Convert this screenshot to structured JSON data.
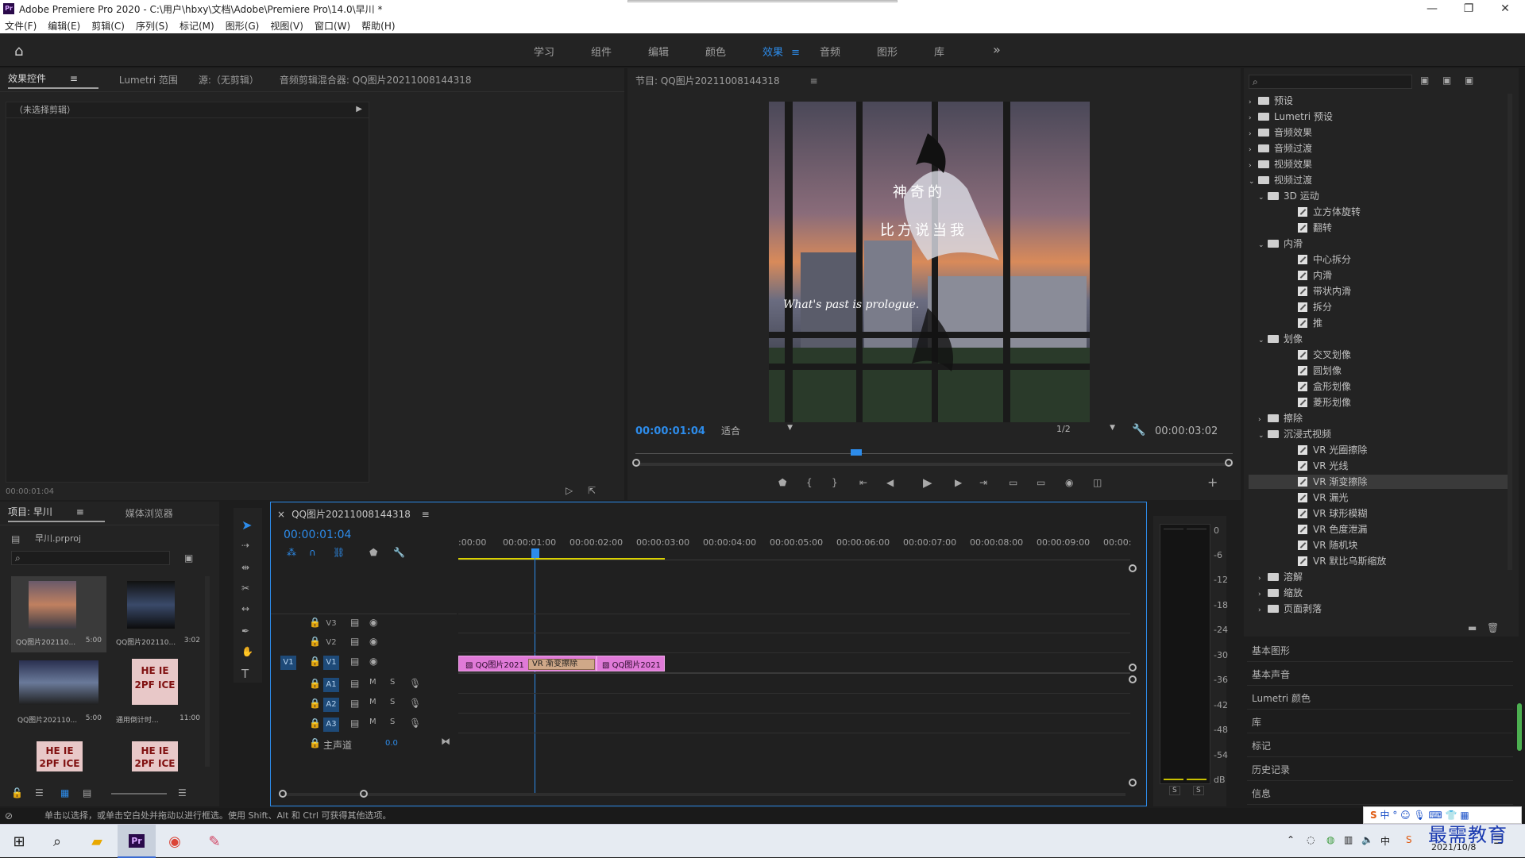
{
  "titlebar": {
    "title": "Adobe Premiere Pro 2020 - C:\\用户\\hbxy\\文档\\Adobe\\Premiere Pro\\14.0\\早川 *",
    "min": "—",
    "max": "❐",
    "close": "✕"
  },
  "menu": [
    "文件(F)",
    "编辑(E)",
    "剪辑(C)",
    "序列(S)",
    "标记(M)",
    "图形(G)",
    "视图(V)",
    "窗口(W)",
    "帮助(H)"
  ],
  "workspaces": [
    "学习",
    "组件",
    "编辑",
    "颜色",
    "效果",
    "音频",
    "图形",
    "库"
  ],
  "workspace_active_index": 4,
  "ws_more": "»",
  "source_tabs": [
    "效果控件",
    "Lumetri 范围",
    "源:（无剪辑）",
    "音频剪辑混合器: QQ图片20211008144318"
  ],
  "effect_controls": {
    "no_clip": "（未选择剪辑）",
    "timecode": "00:00:01:04"
  },
  "program": {
    "title": "节目: QQ图片20211008144318",
    "tc_left": "00:00:01:04",
    "fit": "适合",
    "quality": "1/2",
    "tc_right": "00:00:03:02",
    "overlay": {
      "line1": "神奇的",
      "line2": "比方说当我",
      "line3": "What's past is prologue."
    }
  },
  "project": {
    "tabs": [
      "项目: 早川",
      "媒体浏览器"
    ],
    "file": "早川.prproj",
    "items": [
      {
        "name": "QQ图片202110...",
        "dur": "5:00"
      },
      {
        "name": "QQ图片202110...",
        "dur": "3:02"
      },
      {
        "name": "QQ图片202110...",
        "dur": "5:00"
      },
      {
        "name": "通用倒计时...",
        "dur": "11:00"
      },
      {
        "name": "",
        "dur": ""
      },
      {
        "name": "",
        "dur": ""
      }
    ],
    "leader_text": "HE IE\n2PF ICE"
  },
  "timeline": {
    "title": "QQ图片20211008144318",
    "timecode": "00:00:01:04",
    "ruler": [
      ":00:00",
      "00:00:01:00",
      "00:00:02:00",
      "00:00:03:00",
      "00:00:04:00",
      "00:00:05:00",
      "00:00:06:00",
      "00:00:07:00",
      "00:00:08:00",
      "00:00:09:00",
      "00:00:"
    ],
    "tracks": [
      {
        "id": "V3",
        "src": ""
      },
      {
        "id": "V2",
        "src": ""
      },
      {
        "id": "V1",
        "src": "V1"
      },
      {
        "id": "A1",
        "src": ""
      },
      {
        "id": "A2",
        "src": ""
      },
      {
        "id": "A3",
        "src": ""
      }
    ],
    "master": "主声道",
    "master_val": "0.0",
    "clip1": "QQ图片2021",
    "clip2": "QQ图片2021",
    "transition": "VR 渐变擦除",
    "m": "M",
    "s": "S"
  },
  "meter": {
    "scale": [
      "0",
      "-6",
      "-12",
      "-18",
      "-24",
      "-30",
      "-36",
      "-42",
      "-48",
      "-54",
      "dB"
    ],
    "s1": "S",
    "s2": "S"
  },
  "effects_tree": [
    {
      "label": "预设",
      "level": 0,
      "type": "folder",
      "open": false
    },
    {
      "label": "Lumetri 预设",
      "level": 0,
      "type": "folder",
      "open": false
    },
    {
      "label": "音频效果",
      "level": 0,
      "type": "folder",
      "open": false
    },
    {
      "label": "音频过渡",
      "level": 0,
      "type": "folder",
      "open": false
    },
    {
      "label": "视频效果",
      "level": 0,
      "type": "folder",
      "open": false
    },
    {
      "label": "视频过渡",
      "level": 0,
      "type": "folder",
      "open": true
    },
    {
      "label": "3D 运动",
      "level": 1,
      "type": "folder",
      "open": true
    },
    {
      "label": "立方体旋转",
      "level": 2,
      "type": "effect"
    },
    {
      "label": "翻转",
      "level": 2,
      "type": "effect"
    },
    {
      "label": "内滑",
      "level": 1,
      "type": "folder",
      "open": true
    },
    {
      "label": "中心拆分",
      "level": 2,
      "type": "effect"
    },
    {
      "label": "内滑",
      "level": 2,
      "type": "effect"
    },
    {
      "label": "带状内滑",
      "level": 2,
      "type": "effect"
    },
    {
      "label": "拆分",
      "level": 2,
      "type": "effect"
    },
    {
      "label": "推",
      "level": 2,
      "type": "effect"
    },
    {
      "label": "划像",
      "level": 1,
      "type": "folder",
      "open": true
    },
    {
      "label": "交叉划像",
      "level": 2,
      "type": "effect"
    },
    {
      "label": "圆划像",
      "level": 2,
      "type": "effect"
    },
    {
      "label": "盒形划像",
      "level": 2,
      "type": "effect"
    },
    {
      "label": "菱形划像",
      "level": 2,
      "type": "effect"
    },
    {
      "label": "擦除",
      "level": 1,
      "type": "folder",
      "open": false
    },
    {
      "label": "沉浸式视频",
      "level": 1,
      "type": "folder",
      "open": true
    },
    {
      "label": "VR 光圈擦除",
      "level": 2,
      "type": "effect"
    },
    {
      "label": "VR 光线",
      "level": 2,
      "type": "effect"
    },
    {
      "label": "VR 渐变擦除",
      "level": 2,
      "type": "effect",
      "selected": true
    },
    {
      "label": "VR 漏光",
      "level": 2,
      "type": "effect"
    },
    {
      "label": "VR 球形模糊",
      "level": 2,
      "type": "effect"
    },
    {
      "label": "VR 色度泄漏",
      "level": 2,
      "type": "effect"
    },
    {
      "label": "VR 随机块",
      "level": 2,
      "type": "effect"
    },
    {
      "label": "VR 默比乌斯缩放",
      "level": 2,
      "type": "effect"
    },
    {
      "label": "溶解",
      "level": 1,
      "type": "folder",
      "open": false
    },
    {
      "label": "缩放",
      "level": 1,
      "type": "folder",
      "open": false
    },
    {
      "label": "页面剥落",
      "level": 1,
      "type": "folder",
      "open": false
    }
  ],
  "side_panels": [
    "基本图形",
    "基本声音",
    "Lumetri 颜色",
    "库",
    "标记",
    "历史记录",
    "信息"
  ],
  "status_text": "单击以选择，或单击空白处并拖动以进行框选。使用 Shift、Alt 和 Ctrl 可获得其他选项。",
  "taskbar": {
    "ime": "中",
    "date": "2021/10/8",
    "watermark": "最需教育"
  },
  "colors": {
    "accent": "#2d8ceb",
    "clip": "#e07ad8",
    "playhead": "#2d8ceb"
  }
}
